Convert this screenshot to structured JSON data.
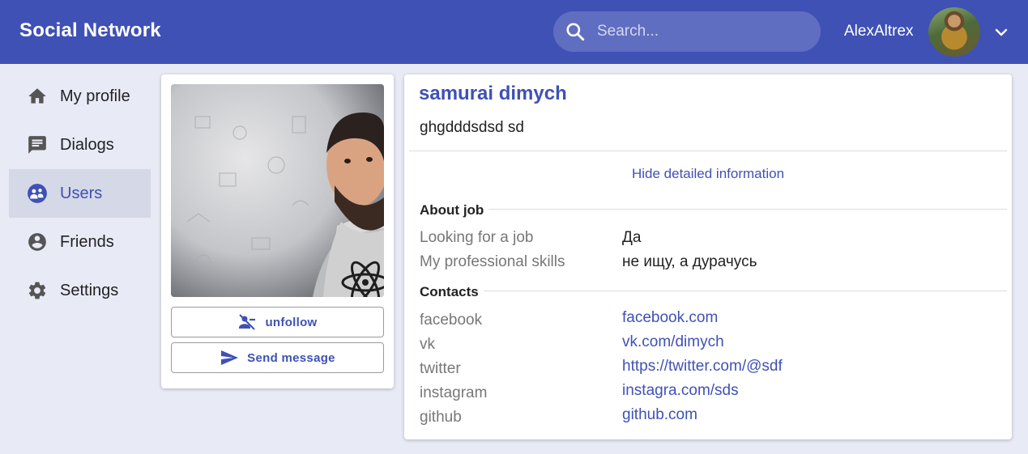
{
  "header": {
    "brand": "Social Network",
    "search": {
      "placeholder": "Search...",
      "value": ""
    },
    "username": "AlexAltrex",
    "avatar_icon": "user-avatar",
    "menu_icon": "chevron-down-icon"
  },
  "sidebar": {
    "items": [
      {
        "label": "My profile",
        "icon": "home-icon",
        "active": false
      },
      {
        "label": "Dialogs",
        "icon": "chat-icon",
        "active": false
      },
      {
        "label": "Users",
        "icon": "users-icon",
        "active": true
      },
      {
        "label": "Friends",
        "icon": "account-circle-icon",
        "active": false
      },
      {
        "label": "Settings",
        "icon": "gear-icon",
        "active": false
      }
    ]
  },
  "profile": {
    "buttons": {
      "unfollow": "unfollow",
      "send_message": "Send message"
    },
    "name": "samurai dimych",
    "status": "ghgdddsdsd sd",
    "toggle_details": "Hide detailed information",
    "about_job": {
      "title": "About job",
      "rows": [
        {
          "label": "Looking for a job",
          "value": "Да"
        },
        {
          "label": "My professional skills",
          "value": "не ищу, а дурачусь"
        }
      ]
    },
    "contacts": {
      "title": "Contacts",
      "rows": [
        {
          "label": "facebook",
          "value": "facebook.com"
        },
        {
          "label": "vk",
          "value": "vk.com/dimych"
        },
        {
          "label": "twitter",
          "value": "https://twitter.com/@sdf"
        },
        {
          "label": "instagram",
          "value": "instagra.com/sds"
        },
        {
          "label": "github",
          "value": "github.com"
        }
      ]
    }
  },
  "colors": {
    "primary": "#3f51b5",
    "background": "#e8eaf6",
    "active_nav": "#d5d8e6"
  }
}
